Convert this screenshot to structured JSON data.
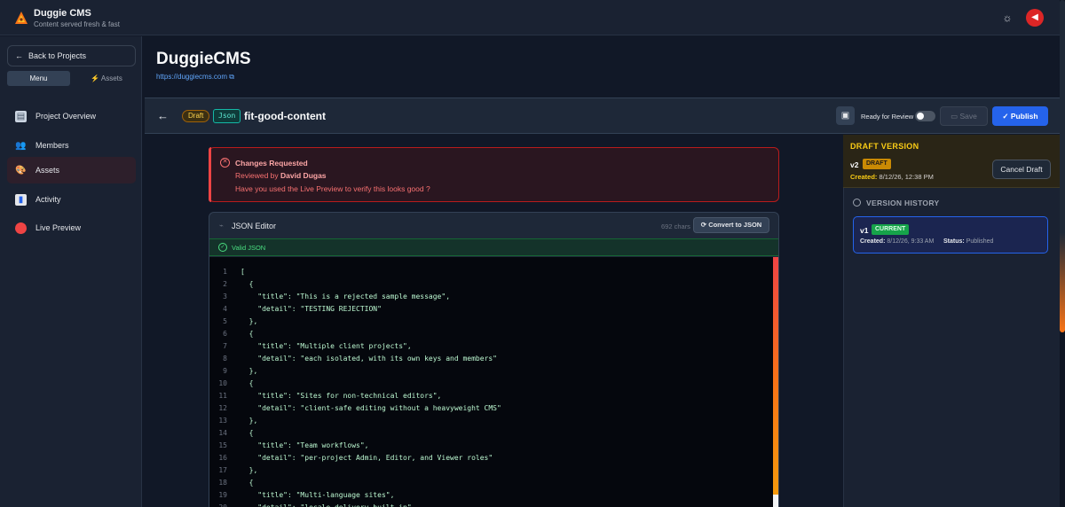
{
  "app": {
    "title": "Duggie CMS",
    "tagline": "Content served fresh & fast"
  },
  "sidebar": {
    "back_label": "Back to Projects",
    "tabs": [
      {
        "label": "Menu"
      },
      {
        "label": "Assets"
      }
    ],
    "items": [
      {
        "label": "Project Overview",
        "icon": "document-icon"
      },
      {
        "label": "Members",
        "icon": "members-icon"
      },
      {
        "label": "Assets",
        "icon": "palette-icon",
        "active": true
      },
      {
        "label": "Activity",
        "icon": "bar-chart-icon"
      },
      {
        "label": "Live Preview",
        "icon": "red-dot-icon"
      }
    ]
  },
  "project": {
    "title": "DuggieCMS",
    "url": "https://duggiecms.com"
  },
  "entry": {
    "status_badge": "Draft",
    "type_badge": "Json",
    "name": "fit-good-content",
    "review_label": "Ready for Review",
    "save_label": "Save",
    "publish_label": "Publish"
  },
  "changes": {
    "title": "Changes Requested",
    "reviewed_by_prefix": "Reviewed by",
    "reviewer": "David Dugas",
    "message": "Have you used the Live Preview to verify this looks good ?"
  },
  "json_editor": {
    "title": "JSON Editor",
    "chars": "692 chars",
    "convert_label": "Convert to JSON",
    "valid_label": "Valid JSON",
    "lines": [
      "[",
      "  {",
      "    \"title\": \"This is a rejected sample message\",",
      "    \"detail\": \"TESTING REJECTION\"",
      "  },",
      "  {",
      "    \"title\": \"Multiple client projects\",",
      "    \"detail\": \"each isolated, with its own keys and members\"",
      "  },",
      "  {",
      "    \"title\": \"Sites for non-technical editors\",",
      "    \"detail\": \"client-safe editing without a heavyweight CMS\"",
      "  },",
      "  {",
      "    \"title\": \"Team workflows\",",
      "    \"detail\": \"per-project Admin, Editor, and Viewer roles\"",
      "  },",
      "  {",
      "    \"title\": \"Multi-language sites\",",
      "    \"detail\": \"locale delivery built in\""
    ]
  },
  "draft": {
    "header": "DRAFT VERSION",
    "version": "v2",
    "pill": "DRAFT",
    "created_label": "Created:",
    "created_value": "8/12/26, 12:38 PM",
    "cancel_label": "Cancel Draft"
  },
  "history": {
    "header": "VERSION HISTORY",
    "version": "v1",
    "pill": "CURRENT",
    "created_label": "Created:",
    "created_value": "8/12/26, 9:33 AM",
    "status_label": "Status:",
    "status_value": "Published"
  },
  "colors": {
    "accent": "#2563eb",
    "danger": "#ef4444",
    "success": "#4ade80",
    "warning": "#facc15"
  }
}
